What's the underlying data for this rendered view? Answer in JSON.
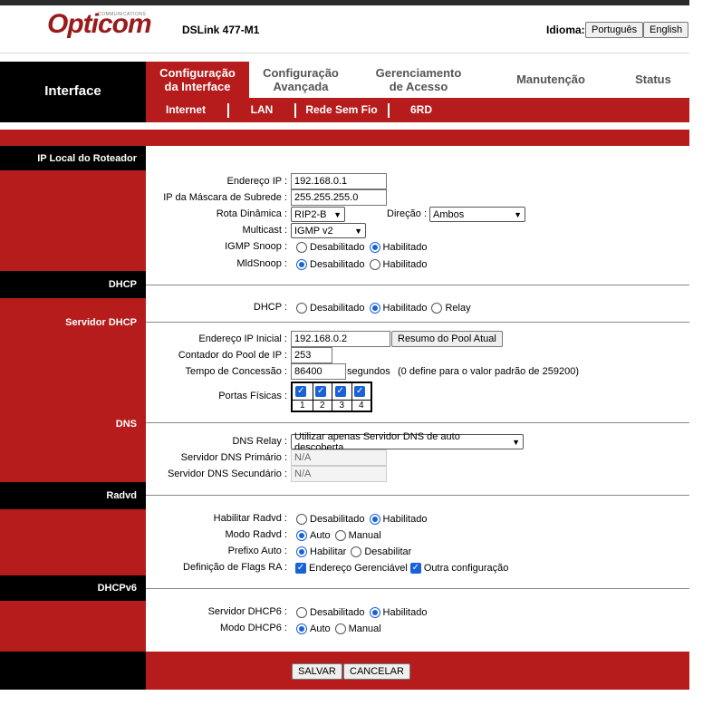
{
  "header": {
    "logo_text": "Opticom",
    "logo_sub": "COMMUNICATIONS",
    "model": "DSLink 477-M1",
    "language_label": "Idioma:",
    "languages": [
      "Português",
      "English"
    ]
  },
  "nav": {
    "section_title": "Interface",
    "tabs": [
      {
        "line1": "Configuração",
        "line2": "da Interface"
      },
      {
        "line1": "Configuração",
        "line2": "Avançada"
      },
      {
        "line1": "Gerenciamento",
        "line2": "de Acesso"
      },
      {
        "line1": "Manutenção",
        "line2": ""
      },
      {
        "line1": "Status",
        "line2": ""
      }
    ],
    "subtabs": [
      "Internet",
      "LAN",
      "Rede Sem Fio",
      "6RD"
    ]
  },
  "sections": {
    "ip_local": "IP Local do Roteador",
    "dhcp": "DHCP",
    "dhcp_server": "Servidor DHCP",
    "dns": "DNS",
    "radvd": "Radvd",
    "dhcpv6": "DHCPv6"
  },
  "ip_local": {
    "ip_label": "Endereço IP :",
    "ip_value": "192.168.0.1",
    "mask_label": "IP da Máscara de Subrede :",
    "mask_value": "255.255.255.0",
    "dyn_route_label": "Rota Dinâmica :",
    "dyn_route_value": "RIP2-B",
    "direction_label": "Direção :",
    "direction_value": "Ambos",
    "multicast_label": "Multicast :",
    "multicast_value": "IGMP v2",
    "igmp_label": "IGMP Snoop :",
    "mld_label": "MldSnoop :",
    "opt_disabled": "Desabilitado",
    "opt_enabled": "Habilitado"
  },
  "dhcp": {
    "dhcp_label": "DHCP :",
    "opt_disabled": "Desabilitado",
    "opt_enabled": "Habilitado",
    "opt_relay": "Relay",
    "start_ip_label": "Endereço IP Inicial :",
    "start_ip_value": "192.168.0.2",
    "pool_button": "Resumo do Pool Atual",
    "pool_count_label": "Contador do Pool de IP :",
    "pool_count_value": "253",
    "lease_label": "Tempo de Concessão :",
    "lease_value": "86400",
    "lease_unit": "segundos",
    "lease_note": "(0 define para o valor padrão de 259200)",
    "ports_label": "Portas Físicas :",
    "ports": [
      "1",
      "2",
      "3",
      "4"
    ]
  },
  "dns": {
    "relay_label": "DNS Relay :",
    "relay_value": "Utilizar apenas Servidor DNS de auto descoberta",
    "primary_label": "Servidor DNS Primário :",
    "primary_value": "N/A",
    "secondary_label": "Servidor DNS Secundário :",
    "secondary_value": "N/A"
  },
  "radvd": {
    "enable_label": "Habilitar Radvd :",
    "mode_label": "Modo Radvd :",
    "prefix_label": "Prefixo Auto :",
    "flags_label": "Definição de Flags RA :",
    "opt_disabled": "Desabilitado",
    "opt_enabled": "Habilitado",
    "opt_auto": "Auto",
    "opt_manual": "Manual",
    "opt_habilitar": "Habilitar",
    "opt_desabilitar": "Desabilitar",
    "flag_managed": "Endereço Gerenciável",
    "flag_other": "Outra configuração"
  },
  "dhcpv6": {
    "server_label": "Servidor DHCP6 :",
    "mode_label": "Modo DHCP6 :",
    "opt_disabled": "Desabilitado",
    "opt_enabled": "Habilitado",
    "opt_auto": "Auto",
    "opt_manual": "Manual"
  },
  "actions": {
    "save": "SALVAR",
    "cancel": "CANCELAR"
  },
  "colors": {
    "brand_red": "#b61c1c",
    "black": "#000000",
    "accent_blue": "#1a62d6"
  }
}
